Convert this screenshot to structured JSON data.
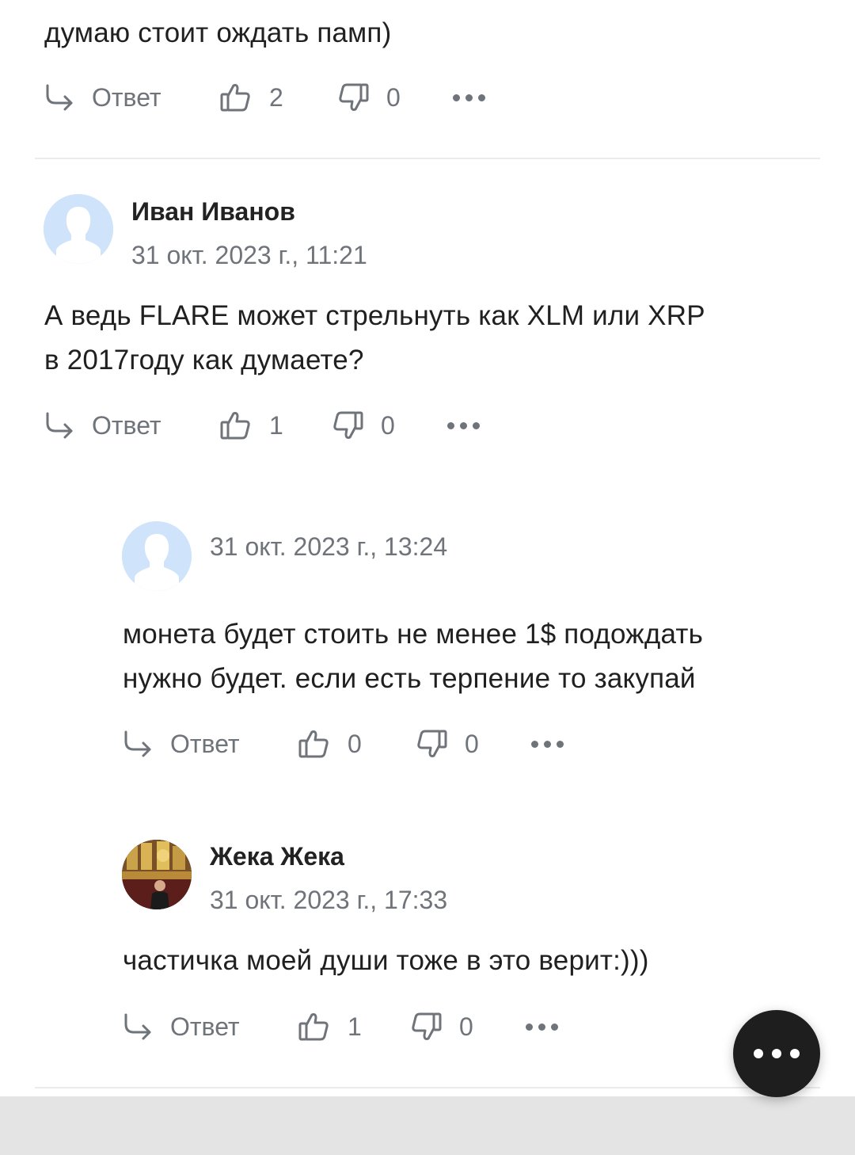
{
  "comments": [
    {
      "text": "думаю стоит ождать памп)",
      "reply_label": "Ответ",
      "likes": "2",
      "dislikes": "0"
    },
    {
      "author": "Иван Иванов",
      "date": "31 окт. 2023 г., 11:21",
      "text_line1": "А ведь FLARE может стрельнуть как XLM или XRP",
      "text_line2": "в 2017году как думаете?",
      "reply_label": "Ответ",
      "likes": "1",
      "dislikes": "0",
      "avatar_icon": "default-user-avatar"
    },
    {
      "author": "",
      "date": "31 окт. 2023 г., 13:24",
      "text_line1": "монета будет стоить не менее 1$ подождать",
      "text_line2": "нужно будет. если есть терпение то закупай",
      "reply_label": "Ответ",
      "likes": "0",
      "dislikes": "0",
      "avatar_icon": "default-user-avatar"
    },
    {
      "author": "Жека Жека",
      "date": "31 окт. 2023 г., 17:33",
      "text": "частичка моей души тоже в это верит:)))",
      "reply_label": "Ответ",
      "likes": "1",
      "dislikes": "0",
      "avatar_icon": "photo-avatar"
    }
  ],
  "icons": {
    "reply": "reply-arrow-icon",
    "like": "thumbs-up-icon",
    "dislike": "thumbs-down-icon",
    "more": "more-dots-icon",
    "fab": "more-dots-icon"
  },
  "colors": {
    "text": "#202020",
    "muted": "#6f737a",
    "avatar_bg": "#cfe3fa",
    "fab_bg": "#1e1e1e",
    "divider": "#ebebeb"
  }
}
